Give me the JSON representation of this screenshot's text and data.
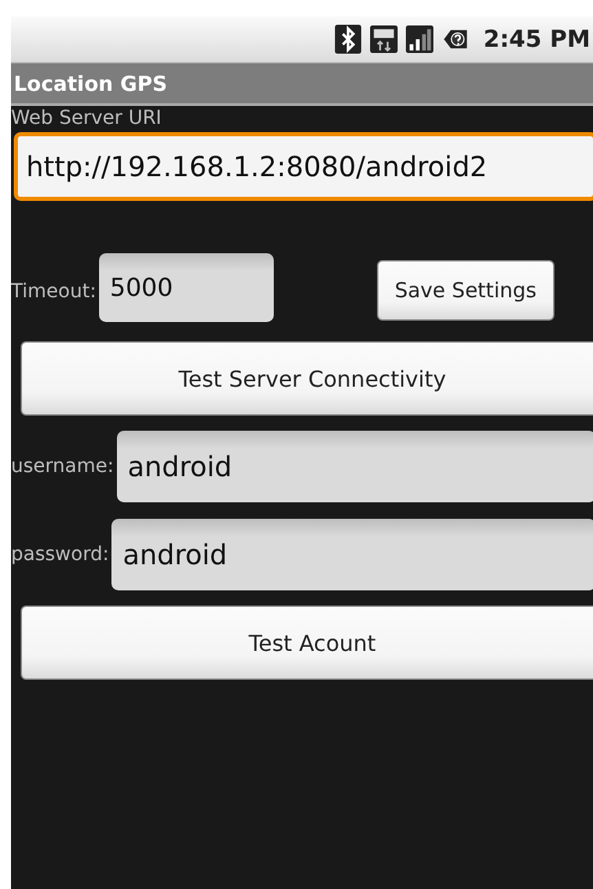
{
  "status_bar": {
    "time": "2:45 PM"
  },
  "title_bar": {
    "title": "Location GPS"
  },
  "uri": {
    "label": "Web Server URI",
    "value": "http://192.168.1.2:8080/android2",
    "focused": true
  },
  "timeout": {
    "label": "Timeout:",
    "value": "5000",
    "focused": false
  },
  "save_button": "Save Settings",
  "test_server_button": "Test Server Connectivity",
  "username": {
    "label": "username:",
    "value": "android",
    "focused": false
  },
  "password": {
    "label": "password:",
    "value": "android",
    "focused": false
  },
  "test_account_button": "Test Acount"
}
